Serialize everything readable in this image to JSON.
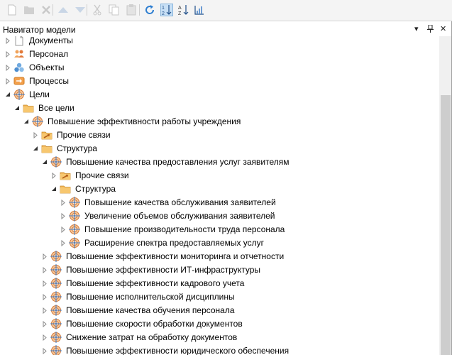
{
  "toolbar": {
    "buttons": [
      {
        "icon": "new-document-icon"
      },
      {
        "icon": "folder-icon"
      },
      {
        "icon": "delete-icon"
      },
      {
        "icon": "move-up-icon"
      },
      {
        "icon": "move-down-icon"
      },
      {
        "icon": "cut-icon"
      },
      {
        "icon": "copy-icon"
      },
      {
        "icon": "paste-icon"
      },
      {
        "icon": "refresh-icon"
      },
      {
        "icon": "sort-numeric-icon",
        "active": true
      },
      {
        "icon": "sort-alpha-icon"
      },
      {
        "icon": "sort-custom-icon"
      }
    ]
  },
  "panel": {
    "title": "Навигатор модели",
    "controls": {
      "dropdown": "▾",
      "pin": "ᛘ",
      "close": "✕"
    }
  },
  "tree": [
    {
      "level": 0,
      "expanded": false,
      "icon": "document-icon",
      "label": "Документы"
    },
    {
      "level": 0,
      "expanded": false,
      "icon": "people-icon",
      "label": "Персонал"
    },
    {
      "level": 0,
      "expanded": false,
      "icon": "objects-icon",
      "label": "Объекты"
    },
    {
      "level": 0,
      "expanded": false,
      "icon": "process-icon",
      "label": "Процессы"
    },
    {
      "level": 0,
      "expanded": true,
      "icon": "target-icon",
      "label": "Цели"
    },
    {
      "level": 1,
      "expanded": true,
      "icon": "folder-icon",
      "label": "Все цели"
    },
    {
      "level": 2,
      "expanded": true,
      "icon": "target-icon",
      "label": "Повышение эффективности работы учреждения"
    },
    {
      "level": 3,
      "expanded": false,
      "icon": "folder-link-icon",
      "label": "Прочие связи"
    },
    {
      "level": 3,
      "expanded": true,
      "icon": "folder-icon",
      "label": "Структура"
    },
    {
      "level": 4,
      "expanded": true,
      "icon": "target-icon",
      "label": "Повышение качества предоставления услуг заявителям"
    },
    {
      "level": 5,
      "expanded": false,
      "icon": "folder-link-icon",
      "label": "Прочие связи"
    },
    {
      "level": 5,
      "expanded": true,
      "icon": "folder-icon",
      "label": "Структура"
    },
    {
      "level": 6,
      "expanded": false,
      "icon": "target-icon",
      "label": "Повышение качества обслуживания заявителей"
    },
    {
      "level": 6,
      "expanded": false,
      "icon": "target-icon",
      "label": "Увеличение объемов обслуживания заявителей"
    },
    {
      "level": 6,
      "expanded": false,
      "icon": "target-icon",
      "label": "Повышение производительности труда персонала"
    },
    {
      "level": 6,
      "expanded": false,
      "icon": "target-icon",
      "label": "Расширение спектра предоставляемых услуг"
    },
    {
      "level": 4,
      "expanded": false,
      "icon": "target-icon",
      "label": "Повышение эффективности мониторинга и отчетности"
    },
    {
      "level": 4,
      "expanded": false,
      "icon": "target-icon",
      "label": "Повышение эффективности ИТ-инфраструктуры"
    },
    {
      "level": 4,
      "expanded": false,
      "icon": "target-icon",
      "label": "Повышение эффективности кадрового учета"
    },
    {
      "level": 4,
      "expanded": false,
      "icon": "target-icon",
      "label": "Повышение исполнительской дисциплины"
    },
    {
      "level": 4,
      "expanded": false,
      "icon": "target-icon",
      "label": "Повышение качества обучения персонала"
    },
    {
      "level": 4,
      "expanded": false,
      "icon": "target-icon",
      "label": "Повышение скорости обработки документов"
    },
    {
      "level": 4,
      "expanded": false,
      "icon": "target-icon",
      "label": "Снижение затрат на обработку документов"
    },
    {
      "level": 4,
      "expanded": false,
      "icon": "target-icon",
      "label": "Повышение эффективности юридического обеспечения"
    }
  ]
}
